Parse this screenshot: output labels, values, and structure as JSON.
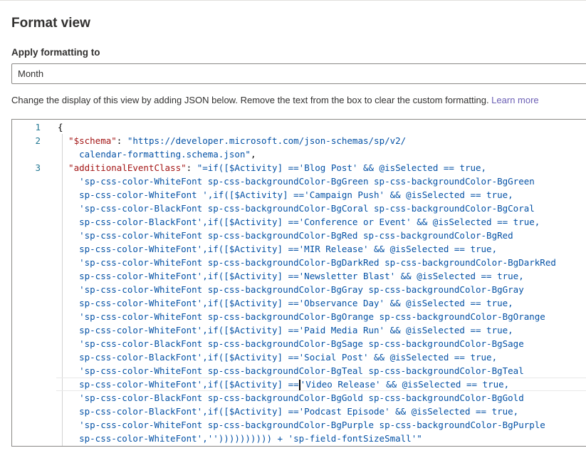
{
  "panel": {
    "title": "Format view",
    "apply_label": "Apply formatting to",
    "apply_value": "Month",
    "description": "Change the display of this view by adding JSON below. Remove the text from the box to clear the custom formatting. ",
    "learn_more": "Learn more"
  },
  "editor": {
    "lines": [
      {
        "num": "1",
        "parts": [
          {
            "c": "p",
            "t": "{"
          }
        ]
      },
      {
        "num": "2",
        "parts": [
          {
            "c": "k",
            "t": "  \"$schema\""
          },
          {
            "c": "p",
            "t": ": "
          },
          {
            "c": "s",
            "t": "\"https://developer.microsoft.com/json-schemas/sp/v2/"
          }
        ]
      },
      {
        "num": "",
        "parts": [
          {
            "c": "s",
            "t": "    calendar-formatting.schema.json\""
          },
          {
            "c": "p",
            "t": ","
          }
        ]
      },
      {
        "num": "3",
        "parts": [
          {
            "c": "k",
            "t": "  \"additionalEventClass\""
          },
          {
            "c": "p",
            "t": ": "
          },
          {
            "c": "s",
            "t": "\"=if([$Activity] =='Blog Post' && @isSelected == true,"
          }
        ]
      },
      {
        "num": "",
        "parts": [
          {
            "c": "s",
            "t": "    'sp-css-color-WhiteFont sp-css-backgroundColor-BgGreen sp-css-backgroundColor-BgGreen"
          }
        ]
      },
      {
        "num": "",
        "parts": [
          {
            "c": "s",
            "t": "    sp-css-color-WhiteFont ',if([$Activity] =='Campaign Push' && @isSelected == true,"
          }
        ]
      },
      {
        "num": "",
        "parts": [
          {
            "c": "s",
            "t": "    'sp-css-color-BlackFont sp-css-backgroundColor-BgCoral sp-css-backgroundColor-BgCoral"
          }
        ]
      },
      {
        "num": "",
        "parts": [
          {
            "c": "s",
            "t": "    sp-css-color-BlackFont',if([$Activity] =='Conference or Event' && @isSelected == true,"
          }
        ]
      },
      {
        "num": "",
        "parts": [
          {
            "c": "s",
            "t": "    'sp-css-color-WhiteFont sp-css-backgroundColor-BgRed sp-css-backgroundColor-BgRed"
          }
        ]
      },
      {
        "num": "",
        "parts": [
          {
            "c": "s",
            "t": "    sp-css-color-WhiteFont',if([$Activity] =='MIR Release' && @isSelected == true,"
          }
        ]
      },
      {
        "num": "",
        "parts": [
          {
            "c": "s",
            "t": "    'sp-css-color-WhiteFont sp-css-backgroundColor-BgDarkRed sp-css-backgroundColor-BgDarkRed"
          }
        ]
      },
      {
        "num": "",
        "parts": [
          {
            "c": "s",
            "t": "    sp-css-color-WhiteFont',if([$Activity] =='Newsletter Blast' && @isSelected == true,"
          }
        ]
      },
      {
        "num": "",
        "parts": [
          {
            "c": "s",
            "t": "    'sp-css-color-WhiteFont sp-css-backgroundColor-BgGray sp-css-backgroundColor-BgGray"
          }
        ]
      },
      {
        "num": "",
        "parts": [
          {
            "c": "s",
            "t": "    sp-css-color-WhiteFont',if([$Activity] =='Observance Day' && @isSelected == true,"
          }
        ]
      },
      {
        "num": "",
        "parts": [
          {
            "c": "s",
            "t": "    'sp-css-color-WhiteFont sp-css-backgroundColor-BgOrange sp-css-backgroundColor-BgOrange"
          }
        ]
      },
      {
        "num": "",
        "parts": [
          {
            "c": "s",
            "t": "    sp-css-color-WhiteFont',if([$Activity] =='Paid Media Run' && @isSelected == true,"
          }
        ]
      },
      {
        "num": "",
        "parts": [
          {
            "c": "s",
            "t": "    'sp-css-color-BlackFont sp-css-backgroundColor-BgSage sp-css-backgroundColor-BgSage"
          }
        ]
      },
      {
        "num": "",
        "parts": [
          {
            "c": "s",
            "t": "    sp-css-color-BlackFont',if([$Activity] =='Social Post' && @isSelected == true,"
          }
        ]
      },
      {
        "num": "",
        "parts": [
          {
            "c": "s",
            "t": "    'sp-css-color-WhiteFont sp-css-backgroundColor-BgTeal sp-css-backgroundColor-BgTeal"
          }
        ]
      },
      {
        "num": "",
        "current": true,
        "cursor_after": "    sp-css-color-WhiteFont',if([$Activity] ==",
        "parts": [
          {
            "c": "s",
            "t": "'Video Release' && @isSelected == true,"
          }
        ]
      },
      {
        "num": "",
        "parts": [
          {
            "c": "s",
            "t": "    'sp-css-color-BlackFont sp-css-backgroundColor-BgGold sp-css-backgroundColor-BgGold"
          }
        ]
      },
      {
        "num": "",
        "parts": [
          {
            "c": "s",
            "t": "    sp-css-color-BlackFont',if([$Activity] =='Podcast Episode' && @isSelected == true,"
          }
        ]
      },
      {
        "num": "",
        "parts": [
          {
            "c": "s",
            "t": "    'sp-css-color-WhiteFont sp-css-backgroundColor-BgPurple sp-css-backgroundColor-BgPurple"
          }
        ]
      },
      {
        "num": "",
        "parts": [
          {
            "c": "s",
            "t": "    sp-css-color-WhiteFont','')))))))))) + 'sp-field-fontSizeSmall'\""
          }
        ]
      }
    ]
  },
  "colors": {
    "line_number": "#237893",
    "json_key": "#a31515",
    "json_string": "#0451a5",
    "link": "#6b5fb5"
  }
}
